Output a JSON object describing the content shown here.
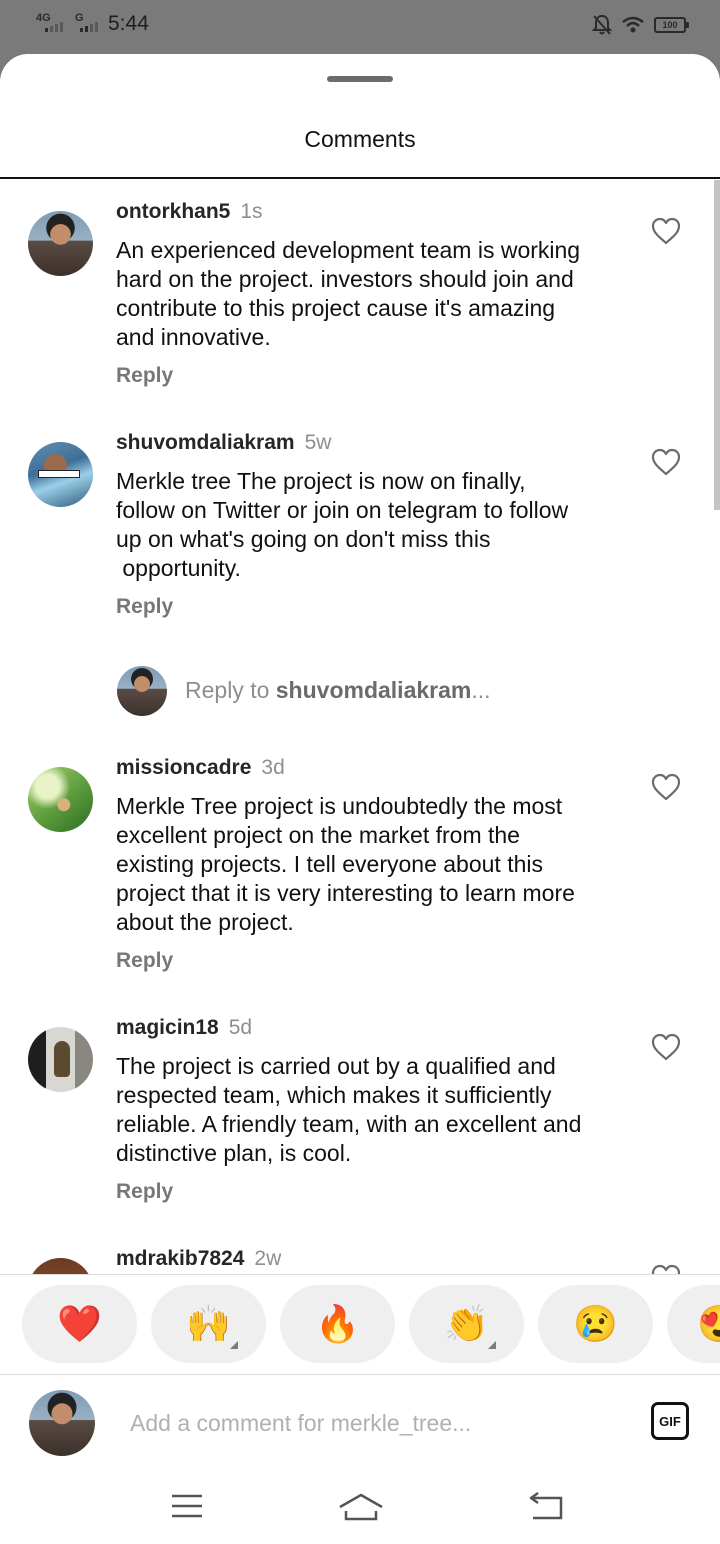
{
  "status_bar": {
    "network1": "4G",
    "network2": "G",
    "time": "5:44",
    "battery": "100"
  },
  "sheet": {
    "title": "Comments"
  },
  "comments": [
    {
      "username": "ontorkhan5",
      "time": "1s",
      "lines": [
        "An experienced development team is working",
        "hard on the project. investors should join and",
        "contribute to this project cause it's amazing",
        "and innovative."
      ],
      "reply_label": "Reply"
    },
    {
      "username": "shuvomdaliakram",
      "time": "5w",
      "lines": [
        "Merkle tree The project is now on finally,",
        "follow on Twitter or join on telegram to follow",
        "up on what's going on don't miss this",
        " opportunity."
      ],
      "reply_label": "Reply"
    },
    {
      "username": "missioncadre",
      "time": "3d",
      "lines": [
        "Merkle Tree project is undoubtedly the most",
        "excellent project on the market from the",
        "existing projects. I tell everyone about this",
        "project that it is very interesting to learn more",
        "about the project."
      ],
      "reply_label": "Reply"
    },
    {
      "username": "magicin18",
      "time": "5d",
      "lines": [
        "The project is carried out by a qualified and",
        "respected team, which makes it sufficiently",
        "reliable. A friendly team, with an excellent and",
        "distinctive plan, is cool."
      ],
      "reply_label": "Reply"
    },
    {
      "username": "mdrakib7824",
      "time": "2w"
    }
  ],
  "reply_prompt": {
    "prefix": "Reply to ",
    "username": "shuvomdaliakram",
    "suffix": "..."
  },
  "reactions": [
    "❤️",
    "🙌",
    "🔥",
    "👏",
    "😢",
    "😍"
  ],
  "comment_input": {
    "placeholder": "Add a comment for merkle_tree...",
    "value": ""
  },
  "gif_button": "GIF",
  "colors": {
    "heart_red": "#ed4956",
    "secondary_text": "#8e8e8e",
    "chip_bg": "#efefef"
  }
}
